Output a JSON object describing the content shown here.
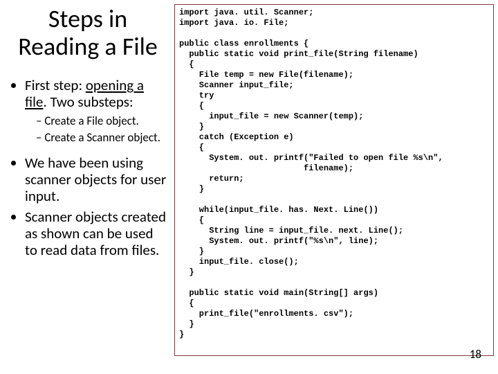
{
  "title": "Steps in Reading a File",
  "bullets": {
    "b0_pre": "First step: ",
    "b0_u": "opening a file",
    "b0_post": ". Two substeps:",
    "s0": "Create a File object.",
    "s1": "Create a Scanner object.",
    "b1": "We have been using scanner objects for user input.",
    "b2": "Scanner objects created as shown can be used to read data from files."
  },
  "code": "import java. util. Scanner;\nimport java. io. File;\n\npublic class enrollments {\n  public static void print_file(String filename)\n  {\n    File temp = new File(filename);\n    Scanner input_file;\n    try\n    {\n      input_file = new Scanner(temp);\n    }\n    catch (Exception e)\n    {\n      System. out. printf(\"Failed to open file %s\\n\",\n                         filename);\n      return;\n    }\n\n    while(input_file. has. Next. Line())\n    {\n      String line = input_file. next. Line();\n      System. out. printf(\"%s\\n\", line);\n    }\n    input_file. close();\n  }\n\n  public static void main(String[] args)\n  {\n    print_file(\"enrollments. csv\");\n  }\n}",
  "pagenum": "18"
}
